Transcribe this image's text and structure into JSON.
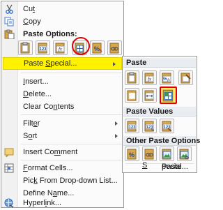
{
  "context_menu": {
    "cut": {
      "pre": "Cu",
      "key": "t",
      "post": "",
      "icon": "scissors-icon"
    },
    "copy": {
      "pre": "",
      "key": "C",
      "post": "opy",
      "icon": "copy-icon"
    },
    "paste_options_header": "Paste Options:",
    "paste_buttons": [
      {
        "name": "paste-option-paste",
        "icon": "clipboard-icon",
        "text": ""
      },
      {
        "name": "paste-option-values",
        "icon": "values-icon",
        "text": "123"
      },
      {
        "name": "paste-option-formulas",
        "icon": "formulas-icon",
        "text": "fx"
      },
      {
        "name": "paste-option-transpose",
        "icon": "transpose-icon",
        "text": ""
      },
      {
        "name": "paste-option-formatting",
        "icon": "formatting-icon",
        "text": "%"
      },
      {
        "name": "paste-option-link",
        "icon": "link-icon",
        "text": ""
      }
    ],
    "paste_special": {
      "pre": "Paste ",
      "key": "S",
      "post": "pecial..."
    },
    "insert": {
      "pre": "",
      "key": "I",
      "post": "nsert..."
    },
    "delete": {
      "pre": "",
      "key": "D",
      "post": "elete..."
    },
    "clear_contents": {
      "pre": "Clear Co",
      "key": "n",
      "post": "tents"
    },
    "filter": {
      "pre": "Filt",
      "key": "e",
      "post": "r"
    },
    "sort": {
      "pre": "S",
      "key": "o",
      "post": "rt"
    },
    "insert_comment": {
      "pre": "Insert Co",
      "key": "m",
      "post": "ment"
    },
    "format_cells": {
      "pre": "",
      "key": "F",
      "post": "ormat Cells..."
    },
    "pick_dropdown": {
      "pre": "Pic",
      "key": "k",
      "post": " From Drop-down List..."
    },
    "define_name": {
      "pre": "Define N",
      "key": "a",
      "post": "me..."
    },
    "hyperlink": {
      "pre": "Hyperl",
      "key": "i",
      "post": "nk..."
    }
  },
  "submenu": {
    "paste_header": "Paste",
    "paste_values_header": "Paste Values",
    "other_header": "Other Paste Options",
    "paste_special_link": {
      "pre": "Paste ",
      "key": "S",
      "post": "pecial..."
    },
    "paste_values_labels": [
      "123",
      "123",
      "123"
    ],
    "accent_highlight": "#fff200",
    "accent_red": "#e00000"
  }
}
